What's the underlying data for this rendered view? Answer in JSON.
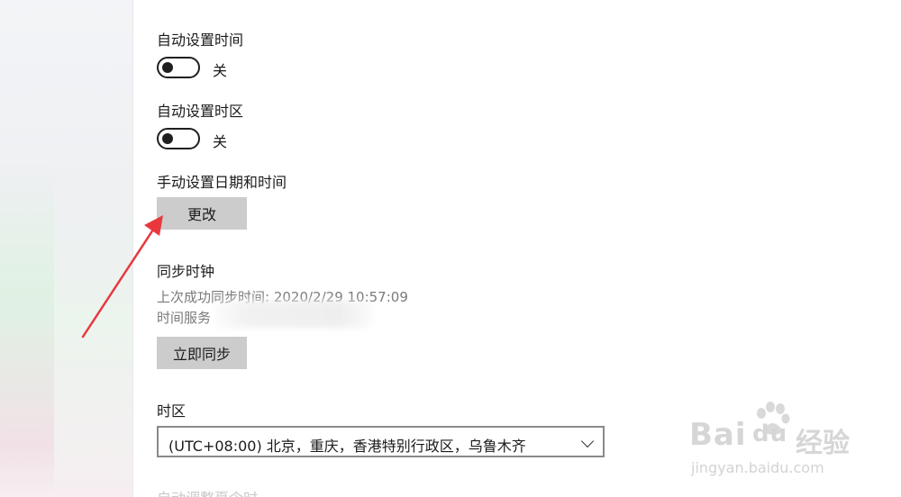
{
  "settings": {
    "auto_time": {
      "label": "自动设置时间",
      "state": "关"
    },
    "auto_timezone": {
      "label": "自动设置时区",
      "state": "关"
    },
    "manual": {
      "label": "手动设置日期和时间",
      "button": "更改"
    },
    "sync": {
      "label": "同步时钟",
      "last_sync": "上次成功同步时间: 2020/2/29 10:57:09",
      "server_label": "时间服务",
      "button": "立即同步"
    },
    "timezone": {
      "label": "时区",
      "selected": "(UTC+08:00) 北京，重庆，香港特别行政区，乌鲁木齐"
    },
    "dst_label": "自动调整夏令时"
  },
  "annotation": {
    "arrow_color": "#e8383d"
  },
  "watermark": {
    "brand": "Bai",
    "brand2": "du",
    "cn": "经验",
    "url": "jingyan.baidu.com"
  }
}
